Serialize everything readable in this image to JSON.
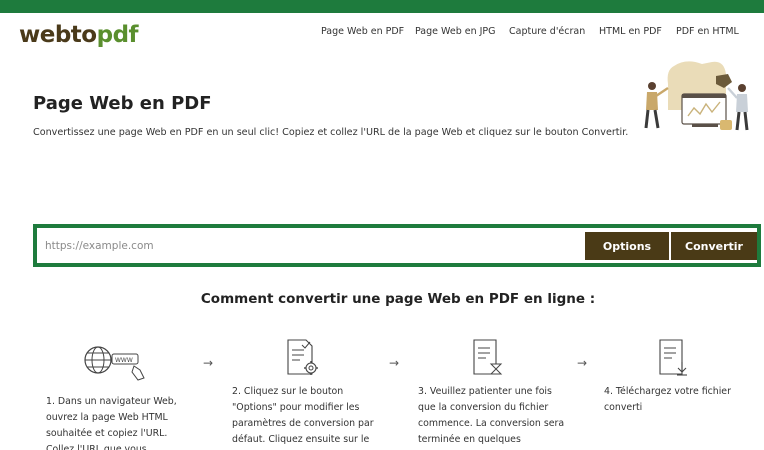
{
  "brand": {
    "logo_part1": "webto",
    "logo_part2": "pdf"
  },
  "nav": {
    "items": [
      {
        "label": "Page Web en PDF"
      },
      {
        "label": "Page Web en JPG"
      },
      {
        "label": "Capture d'écran"
      },
      {
        "label": "HTML en PDF"
      },
      {
        "label": "PDF en HTML"
      }
    ]
  },
  "hero": {
    "title": "Page Web en PDF",
    "subtitle": "Convertissez une page Web en PDF en un seul clic! Copiez et collez l'URL de la page Web et cliquez sur le bouton Convertir."
  },
  "converter": {
    "placeholder": "https://example.com",
    "options_label": "Options",
    "convert_label": "Convertir"
  },
  "how": {
    "title": "Comment convertir une page Web en PDF en ligne :",
    "steps": [
      {
        "icon": "globe-url-icon",
        "lines": [
          "1. Dans un navigateur Web,",
          "ouvrez la page Web HTML",
          "souhaitée et copiez l'URL.",
          "Collez l'URL que vous"
        ]
      },
      {
        "icon": "document-settings-icon",
        "lines": [
          "2. Cliquez sur le bouton",
          "\"Options\" pour modifier les",
          "paramètres de conversion par",
          "défaut. Cliquez ensuite sur le"
        ]
      },
      {
        "icon": "document-hourglass-icon",
        "lines": [
          "3. Veuillez patienter une fois",
          "que la conversion du fichier",
          "commence. La conversion sera",
          "terminée en quelques"
        ]
      },
      {
        "icon": "document-download-icon",
        "lines": [
          "4. Téléchargez votre fichier",
          "converti"
        ]
      }
    ]
  },
  "colors": {
    "accent_green": "#1e7b3d",
    "button_brown": "#4a3a16",
    "logo_green": "#5a8f2e"
  }
}
